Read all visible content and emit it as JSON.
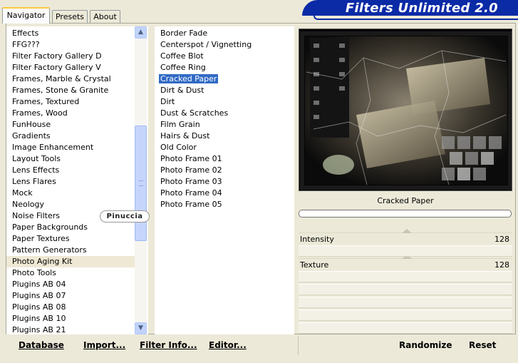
{
  "tabs": [
    {
      "label": "Navigator",
      "active": true
    },
    {
      "label": "Presets",
      "active": false
    },
    {
      "label": "About",
      "active": false
    }
  ],
  "banner": {
    "title": "Filters Unlimited 2.0",
    "color": "#0a2aa6"
  },
  "categories": [
    "Effects",
    "FFG???",
    "Filter Factory Gallery D",
    "Filter Factory Gallery V",
    "Frames, Marble & Crystal",
    "Frames, Stone & Granite",
    "Frames, Textured",
    "Frames, Wood",
    "FunHouse",
    "Gradients",
    "Image Enhancement",
    "Layout Tools",
    "Lens Effects",
    "Lens Flares",
    "Mock",
    "Neology",
    "Noise Filters",
    "Paper Backgrounds",
    "Paper Textures",
    "Pattern Generators",
    "Photo Aging Kit",
    "Photo Tools",
    "Plugins AB 04",
    "Plugins AB 07",
    "Plugins AB 08",
    "Plugins AB 10",
    "Plugins AB 21"
  ],
  "selected_category": "Photo Aging Kit",
  "filters": [
    "Border Fade",
    "Centerspot / Vignetting",
    "Coffee Blot",
    "Coffee Ring",
    "Cracked Paper",
    "Dirt & Dust",
    "Dirt",
    "Dust & Scratches",
    "Film Grain",
    "Hairs & Dust",
    "Old Color",
    "Photo Frame 01",
    "Photo Frame 02",
    "Photo Frame 03",
    "Photo Frame 04",
    "Photo Frame 05"
  ],
  "selected_filter": "Cracked Paper",
  "watermark": "Pinuccia",
  "preview": {
    "filter_name": "Cracked Paper"
  },
  "params": [
    {
      "label": "Intensity",
      "value": "128"
    },
    {
      "label": "Texture",
      "value": "128"
    }
  ],
  "buttons": {
    "database": "Database",
    "import": "Import...",
    "filter_info": "Filter Info...",
    "editor": "Editor...",
    "randomize": "Randomize",
    "reset": "Reset"
  },
  "colors": {
    "selection": "#316ac5",
    "background": "#ece9d8"
  }
}
